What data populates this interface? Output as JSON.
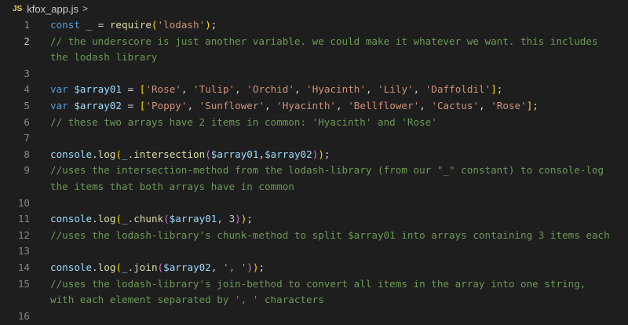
{
  "breadcrumb": {
    "file_badge": "JS",
    "file_name": "kfox_app.js",
    "chevron": ">"
  },
  "editor": {
    "active_line": 2,
    "lines": [
      {
        "n": "1",
        "tokens": [
          [
            "kw",
            "const "
          ],
          [
            "var",
            "_ "
          ],
          [
            "pn",
            "= "
          ],
          [
            "fn",
            "require"
          ],
          [
            "br1",
            "("
          ],
          [
            "str",
            "'lodash'"
          ],
          [
            "br1",
            ")"
          ],
          [
            "pn",
            ";"
          ]
        ]
      },
      {
        "n": "2",
        "tokens": [
          [
            "cmt",
            "// the underscore is just another variable. we could make it whatever we want. this includes"
          ]
        ]
      },
      {
        "n": "",
        "tokens": [
          [
            "cmt",
            "the lodash library"
          ]
        ]
      },
      {
        "n": "3",
        "tokens": []
      },
      {
        "n": "4",
        "tokens": [
          [
            "kw",
            "var "
          ],
          [
            "var",
            "$array01 "
          ],
          [
            "pn",
            "= "
          ],
          [
            "br1",
            "["
          ],
          [
            "str",
            "'Rose'"
          ],
          [
            "pn",
            ", "
          ],
          [
            "str",
            "'Tulip'"
          ],
          [
            "pn",
            ", "
          ],
          [
            "str",
            "'Orchid'"
          ],
          [
            "pn",
            ", "
          ],
          [
            "str",
            "'Hyacinth'"
          ],
          [
            "pn",
            ", "
          ],
          [
            "str",
            "'Lily'"
          ],
          [
            "pn",
            ", "
          ],
          [
            "str",
            "'Daffoldil'"
          ],
          [
            "br1",
            "]"
          ],
          [
            "pn",
            ";"
          ]
        ]
      },
      {
        "n": "5",
        "tokens": [
          [
            "kw",
            "var "
          ],
          [
            "var",
            "$array02 "
          ],
          [
            "pn",
            "= "
          ],
          [
            "br1",
            "["
          ],
          [
            "str",
            "'Poppy'"
          ],
          [
            "pn",
            ", "
          ],
          [
            "str",
            "'Sunflower'"
          ],
          [
            "pn",
            ", "
          ],
          [
            "str",
            "'Hyacinth'"
          ],
          [
            "pn",
            ", "
          ],
          [
            "str",
            "'Bellflower'"
          ],
          [
            "pn",
            ", "
          ],
          [
            "str",
            "'Cactus'"
          ],
          [
            "pn",
            ", "
          ],
          [
            "str",
            "'Rose'"
          ],
          [
            "br1",
            "]"
          ],
          [
            "pn",
            ";"
          ]
        ]
      },
      {
        "n": "6",
        "tokens": [
          [
            "cmt",
            "// these two arrays have 2 items in common: 'Hyacinth' and 'Rose'"
          ]
        ]
      },
      {
        "n": "7",
        "tokens": []
      },
      {
        "n": "8",
        "tokens": [
          [
            "var",
            "console"
          ],
          [
            "pn",
            "."
          ],
          [
            "fn",
            "log"
          ],
          [
            "br1",
            "("
          ],
          [
            "var",
            "_"
          ],
          [
            "pn",
            "."
          ],
          [
            "fn",
            "intersection"
          ],
          [
            "br2",
            "("
          ],
          [
            "var",
            "$array01"
          ],
          [
            "pn",
            ","
          ],
          [
            "var",
            "$array02"
          ],
          [
            "br2",
            ")"
          ],
          [
            "br1",
            ")"
          ],
          [
            "pn",
            ";"
          ]
        ]
      },
      {
        "n": "9",
        "tokens": [
          [
            "cmt",
            "//uses the intersection-method from the lodash-library (from our \"_\" constant) to console-log"
          ]
        ]
      },
      {
        "n": "",
        "tokens": [
          [
            "cmt",
            "the items that both arrays have in common"
          ]
        ]
      },
      {
        "n": "10",
        "tokens": []
      },
      {
        "n": "11",
        "tokens": [
          [
            "var",
            "console"
          ],
          [
            "pn",
            "."
          ],
          [
            "fn",
            "log"
          ],
          [
            "br1",
            "("
          ],
          [
            "var",
            "_"
          ],
          [
            "pn",
            "."
          ],
          [
            "fn",
            "chunk"
          ],
          [
            "br2",
            "("
          ],
          [
            "var",
            "$array01"
          ],
          [
            "pn",
            ", "
          ],
          [
            "num",
            "3"
          ],
          [
            "br2",
            ")"
          ],
          [
            "br1",
            ")"
          ],
          [
            "pn",
            ";"
          ]
        ]
      },
      {
        "n": "12",
        "tokens": [
          [
            "cmt",
            "//uses the lodash-library's chunk-method to split $array01 into arrays containing 3 items each"
          ]
        ]
      },
      {
        "n": "13",
        "tokens": []
      },
      {
        "n": "14",
        "tokens": [
          [
            "var",
            "console"
          ],
          [
            "pn",
            "."
          ],
          [
            "fn",
            "log"
          ],
          [
            "br1",
            "("
          ],
          [
            "var",
            "_"
          ],
          [
            "pn",
            "."
          ],
          [
            "fn",
            "join"
          ],
          [
            "br2",
            "("
          ],
          [
            "var",
            "$array02"
          ],
          [
            "pn",
            ", "
          ],
          [
            "str",
            "', '"
          ],
          [
            "br2",
            ")"
          ],
          [
            "br1",
            ")"
          ],
          [
            "pn",
            ";"
          ]
        ]
      },
      {
        "n": "15",
        "tokens": [
          [
            "cmt",
            "//uses the lodash-library's join-bethod to convert all items in the array into one string,"
          ]
        ]
      },
      {
        "n": "",
        "tokens": [
          [
            "cmt",
            "with each element separated by ', ' characters"
          ]
        ]
      },
      {
        "n": "16",
        "tokens": []
      }
    ]
  }
}
